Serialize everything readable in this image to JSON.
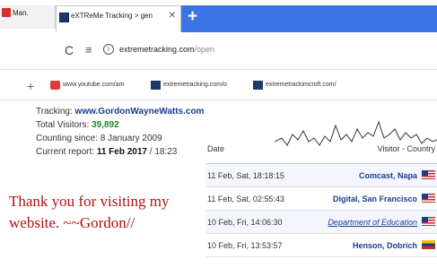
{
  "browser": {
    "prev_tab": {
      "label": "Man."
    },
    "active_tab": {
      "label": "eXTReMe Tracking > gen"
    },
    "address": {
      "host": "extremetracking.com",
      "path": "/open"
    },
    "bookmarks": [
      {
        "label": "www.youtube.com/am"
      },
      {
        "label": "extremetracking.com/o"
      },
      {
        "label": "extremetrackimcroft.com/"
      }
    ]
  },
  "stats": {
    "tracking_label": "Tracking:",
    "tracking_value": "www.GordonWayneWatts.com",
    "visitors_label": "Total Visitors:",
    "visitors_value": "39,892",
    "since_label": "Counting since:",
    "since_value": "8 January 2009",
    "report_label": "Current report:",
    "report_value": "11 Feb 2017",
    "report_sep": "/",
    "report_time": "18:23"
  },
  "message": {
    "line1": "Thank you for visiting my",
    "line2": "website.    ~~Gordon//"
  },
  "visitor_table": {
    "col_date": "Date",
    "col_visitor": "Visitor - Country",
    "rows": [
      {
        "date": "11 Feb, Sat, 18:18:15",
        "visitor": "Comcast, Napa",
        "flag": "us",
        "style": "bold"
      },
      {
        "date": "11 Feb, Sat, 02:55:43",
        "visitor": "Digital, San Francisco",
        "flag": "us",
        "style": "bold"
      },
      {
        "date": "10 Feb, Fri, 14:06:30",
        "visitor": "Department of Education",
        "flag": "us",
        "style": "underline"
      },
      {
        "date": "10 Feb, Fri, 13:53:57",
        "visitor": "Henson, Dobrich",
        "flag": "ve",
        "style": "bold"
      }
    ]
  },
  "colors": {
    "new_tab_bar": "#3b74e4",
    "link": "#1a3c8e",
    "green_value": "#1e8a2a",
    "message": "#b01010"
  },
  "icons": [
    "reload-icon",
    "page-menu-icon",
    "site-info-icon",
    "new-tab-plus-icon",
    "tab-close-icon",
    "bookmark-add-icon",
    "flag-icon"
  ]
}
